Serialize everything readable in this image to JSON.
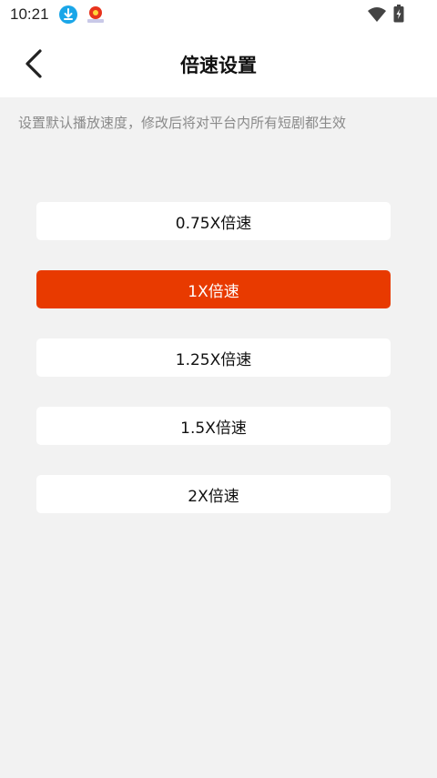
{
  "status_bar": {
    "time": "10:21",
    "icons": [
      "download-icon",
      "app-notification-icon",
      "wifi-icon",
      "battery-charging-icon"
    ]
  },
  "header": {
    "title": "倍速设置",
    "back_icon": "chevron-left-icon"
  },
  "description": "设置默认播放速度，修改后将对平台内所有短剧都生效",
  "speed_options": [
    {
      "label": "0.75X倍速",
      "selected": false
    },
    {
      "label": "1X倍速",
      "selected": true
    },
    {
      "label": "1.25X倍速",
      "selected": false
    },
    {
      "label": "1.5X倍速",
      "selected": false
    },
    {
      "label": "2X倍速",
      "selected": false
    }
  ],
  "colors": {
    "accent": "#e83a00",
    "background": "#f2f2f2",
    "card": "#ffffff",
    "download_icon": "#1aa6e8"
  }
}
